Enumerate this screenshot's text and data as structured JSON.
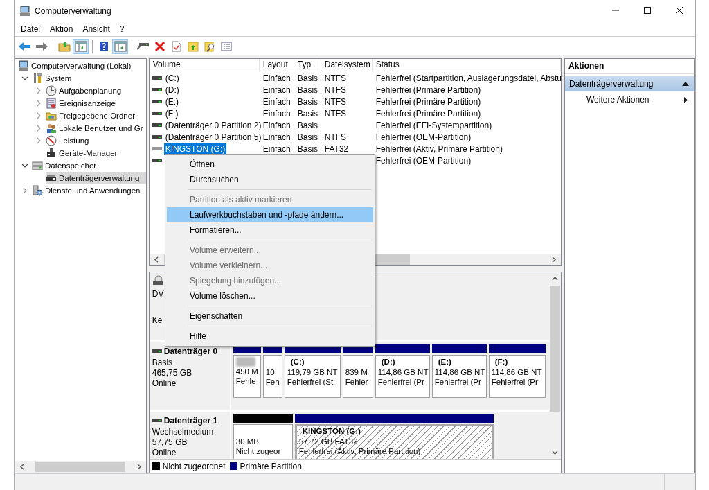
{
  "window": {
    "title": "Computerverwaltung"
  },
  "menu": [
    {
      "label": "Datei"
    },
    {
      "label": "Aktion"
    },
    {
      "label": "Ansicht"
    },
    {
      "label": "?"
    }
  ],
  "toolbar": [
    {
      "buttons": [
        {
          "pressed": false
        },
        {
          "pressed": false
        }
      ]
    },
    {
      "buttons": [
        {
          "pressed": false
        },
        {
          "pressed": true
        }
      ]
    },
    {
      "buttons": [
        {
          "pressed": false
        },
        {
          "pressed": true
        }
      ]
    },
    {
      "buttons": [
        {
          "pressed": false
        },
        {
          "pressed": false
        },
        {
          "pressed": false
        },
        {
          "pressed": false
        },
        {
          "pressed": false
        },
        {
          "pressed": false
        }
      ]
    }
  ],
  "tree": [
    {
      "label": "Computerverwaltung (Lokal)",
      "selected": false,
      "children": [
        {
          "label": "System",
          "expanded": true,
          "selected": false,
          "children": [
            {
              "label": "Aufgabenplanung",
              "expanded": false,
              "selected": false
            },
            {
              "label": "Ereignisanzeige",
              "expanded": false,
              "selected": false
            },
            {
              "label": "Freigegebene Ordner",
              "expanded": false,
              "selected": false
            },
            {
              "label": "Lokale Benutzer und Gr",
              "expanded": false,
              "selected": false
            },
            {
              "label": "Leistung",
              "expanded": false,
              "selected": false
            },
            {
              "label": "Geräte-Manager",
              "selected": false
            }
          ]
        },
        {
          "label": "Datenspeicher",
          "expanded": true,
          "selected": false,
          "children": [
            {
              "label": "Datenträgerverwaltung",
              "selected": true
            }
          ]
        },
        {
          "label": "Dienste und Anwendungen",
          "expanded": false,
          "selected": false
        }
      ]
    }
  ],
  "volume_table": {
    "columns": [
      "Volume",
      "Layout",
      "Typ",
      "Dateisystem",
      "Status"
    ],
    "rows": [
      {
        "volume": "(C:)",
        "layout": "Einfach",
        "type": "Basis",
        "file_system": "NTFS",
        "status": "Fehlerfrei (Startpartition, Auslagerungsdatei, Abstu",
        "selected": false
      },
      {
        "volume": "(D:)",
        "layout": "Einfach",
        "type": "Basis",
        "file_system": "NTFS",
        "status": "Fehlerfrei (Primäre Partition)",
        "selected": false
      },
      {
        "volume": "(E:)",
        "layout": "Einfach",
        "type": "Basis",
        "file_system": "NTFS",
        "status": "Fehlerfrei (Primäre Partition)",
        "selected": false
      },
      {
        "volume": "(F:)",
        "layout": "Einfach",
        "type": "Basis",
        "file_system": "NTFS",
        "status": "Fehlerfrei (Primäre Partition)",
        "selected": false
      },
      {
        "volume": "(Datenträger 0 Partition 2)",
        "layout": "Einfach",
        "type": "Basis",
        "status": "Fehlerfrei (EFI-Systempartition)",
        "selected": false
      },
      {
        "volume": "(Datenträger 0 Partition 5)",
        "layout": "Einfach",
        "type": "Basis",
        "file_system": "NTFS",
        "status": "Fehlerfrei (OEM-Partition)",
        "selected": false
      },
      {
        "volume": "KINGSTON (G:)",
        "layout": "Einfach",
        "type": "Basis",
        "file_system": "FAT32",
        "status": "Fehlerfrei (Aktiv, Primäre Partition)",
        "selected": true
      },
      {
        "status": "Fehlerfrei (OEM-Partition)",
        "selected": false
      }
    ]
  },
  "disks": [
    {
      "kind": "dvd",
      "lines": [
        "DV",
        "Ke"
      ]
    },
    {
      "kind": "disk",
      "name": "Datenträger 0",
      "lines": [
        "Basis",
        "465,75 GB",
        "Online"
      ],
      "partitions": [
        {
          "title_blurred": true,
          "size": "450 M",
          "status": "Fehle",
          "color": "#000080",
          "selected": false
        },
        {
          "size": "10",
          "status": "Feh",
          "color": "#000080",
          "selected": false
        },
        {
          "title": "(C:)",
          "size": "119,79 GB NT",
          "status": "Fehlerfrei (St",
          "color": "#000080",
          "selected": false
        },
        {
          "size": "839 M",
          "status": "Fehler",
          "color": "#000080",
          "selected": false
        },
        {
          "title": "(D:)",
          "size": "114,86 GB NT",
          "status": "Fehlerfrei (Pr",
          "color": "#000080",
          "selected": false
        },
        {
          "title": "(E:)",
          "size": "114,86 GB NT",
          "status": "Fehlerfrei (Pr",
          "color": "#000080",
          "selected": false
        },
        {
          "title": "(F:)",
          "size": "114,86 GB NT",
          "status": "Fehlerfrei (Pr",
          "color": "#000080",
          "selected": false
        }
      ]
    },
    {
      "kind": "disk",
      "name": "Datenträger 1",
      "lines": [
        "Wechselmedium",
        "57,75 GB",
        "Online"
      ],
      "partitions": [
        {
          "size": "30 MB",
          "status": "Nicht zugeor",
          "color": "#000000",
          "selected": false
        },
        {
          "title": "KINGSTON  (G:)",
          "size": "57,72 GB FAT32",
          "status": "Fehlerfrei (Aktiv, Primäre Partition)",
          "color": "#000080",
          "selected": true
        }
      ]
    }
  ],
  "legend": [
    {
      "label": "Nicht zugeordnet",
      "color": "#000000"
    },
    {
      "label": "Primäre Partition",
      "color": "#000080"
    }
  ],
  "actions": {
    "title": "Aktionen",
    "sections": [
      {
        "label": "Datenträgerverwaltung",
        "expanded": true,
        "items": [
          {
            "label": "Weitere Aktionen"
          }
        ]
      }
    ]
  },
  "context_menu": [
    {
      "kind": "item",
      "label": "Öffnen",
      "disabled": false,
      "selected": false
    },
    {
      "kind": "item",
      "label": "Durchsuchen",
      "disabled": false,
      "selected": false
    },
    {
      "kind": "separator"
    },
    {
      "kind": "item",
      "label": "Partition als aktiv markieren",
      "disabled": true,
      "selected": false
    },
    {
      "kind": "item",
      "label": "Laufwerkbuchstaben und -pfade ändern...",
      "disabled": false,
      "selected": true
    },
    {
      "kind": "item",
      "label": "Formatieren...",
      "disabled": false,
      "selected": false
    },
    {
      "kind": "separator"
    },
    {
      "kind": "item",
      "label": "Volume erweitern...",
      "disabled": true,
      "selected": false
    },
    {
      "kind": "item",
      "label": "Volume verkleinern...",
      "disabled": true,
      "selected": false
    },
    {
      "kind": "item",
      "label": "Spiegelung hinzufügen...",
      "disabled": true,
      "selected": false
    },
    {
      "kind": "item",
      "label": "Volume löschen...",
      "disabled": false,
      "selected": false
    },
    {
      "kind": "separator"
    },
    {
      "kind": "item",
      "label": "Eigenschaften",
      "disabled": false,
      "selected": false
    },
    {
      "kind": "separator"
    },
    {
      "kind": "item",
      "label": "Hilfe",
      "disabled": false,
      "selected": false
    }
  ]
}
